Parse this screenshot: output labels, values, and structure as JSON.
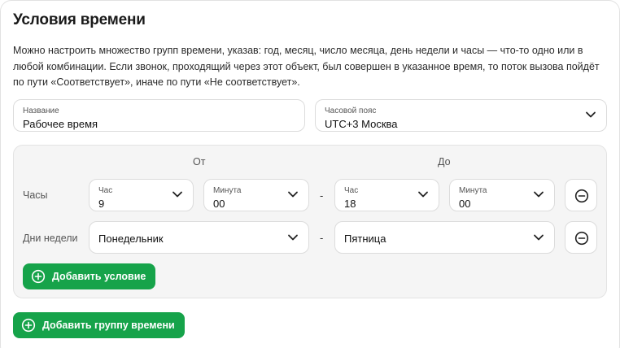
{
  "header": {
    "title": "Условия времени",
    "description": "Можно настроить множество групп времени, указав: год, месяц, число месяца, день недели и часы — что-то одно или в любой комбинации. Если звонок, проходящий через этот объект, был совершен в указанное время, то поток вызова пойдёт по пути «Соответствует», иначе по пути «Не соответствует»."
  },
  "name_field": {
    "label": "Название",
    "value": "Рабочее время"
  },
  "timezone_field": {
    "label": "Часовой пояс",
    "value": "UTC+3 Москва",
    "icon": "chevron-down-icon"
  },
  "group": {
    "from_label": "От",
    "to_label": "До",
    "range_separator": "-",
    "hours_row": {
      "label": "Часы",
      "from_hour": {
        "label": "Час",
        "value": "9"
      },
      "from_minute": {
        "label": "Минута",
        "value": "00"
      },
      "to_hour": {
        "label": "Час",
        "value": "18"
      },
      "to_minute": {
        "label": "Минута",
        "value": "00"
      },
      "remove_icon": "minus-circle-icon"
    },
    "weekdays_row": {
      "label": "Дни недели",
      "from_day": "Понедельник",
      "to_day": "Пятница",
      "remove_icon": "minus-circle-icon"
    },
    "add_condition_label": "Добавить условие"
  },
  "add_group_label": "Добавить группу времени",
  "colors": {
    "accent": "#16a34a",
    "group_bg": "#f5f5f5",
    "border": "#dcdcdc"
  }
}
